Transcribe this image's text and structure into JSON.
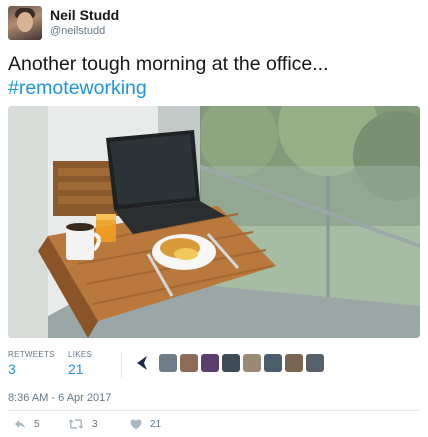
{
  "user": {
    "name": "Neil Studd",
    "handle": "@neilstudd"
  },
  "tweet": {
    "text": "Another tough morning at the office...",
    "hashtag": "#remoteworking"
  },
  "stats": {
    "retweets_label": "RETWEETS",
    "retweets_count": "3",
    "likes_label": "LIKES",
    "likes_count": "21"
  },
  "timestamp": "8:36 AM - 6 Apr 2017",
  "actions": {
    "reply_count": "5",
    "retweet_count": "3",
    "like_count": "21"
  },
  "colors": {
    "link": "#1b95e0",
    "secondary_text": "#657786",
    "divider": "#e1e8ed"
  }
}
